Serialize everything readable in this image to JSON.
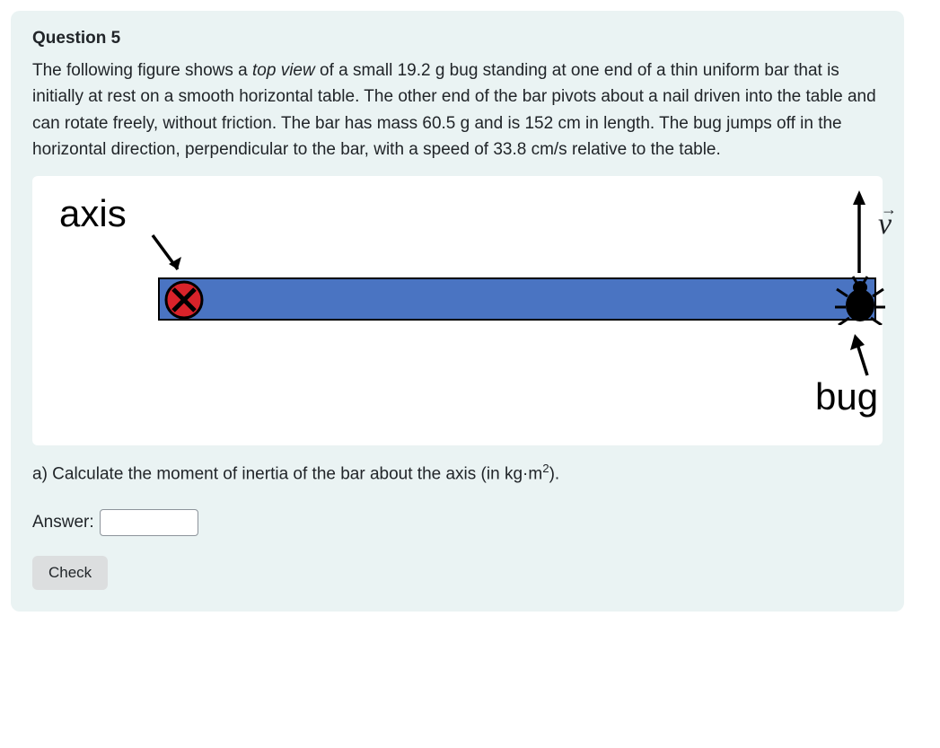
{
  "question": {
    "title": "Question 5",
    "body_html": "The following figure shows a <span class=\"italic\">top view</span> of a small 19.2 g bug standing at one end of a thin uniform bar that is initially at rest on a smooth horizontal table. The other end of the bar pivots about a nail driven into the table and can rotate freely, without friction. The bar has mass 60.5 g and is 152 cm in length. The bug jumps off in the horizontal direction, perpendicular to the bar, with a speed of 33.8 cm/s relative to the table.",
    "figure": {
      "axis_label": "axis",
      "bug_label": "bug",
      "v_label": "v"
    },
    "part_a_html": "a) Calculate the moment of inertia of the bar about the axis (in kg·m<sup>2</sup>).",
    "answer_label": "Answer:",
    "answer_value": "",
    "check_label": "Check"
  },
  "given": {
    "bug_mass_g": 19.2,
    "bar_mass_g": 60.5,
    "bar_length_cm": 152,
    "bug_speed_cm_per_s": 33.8
  }
}
